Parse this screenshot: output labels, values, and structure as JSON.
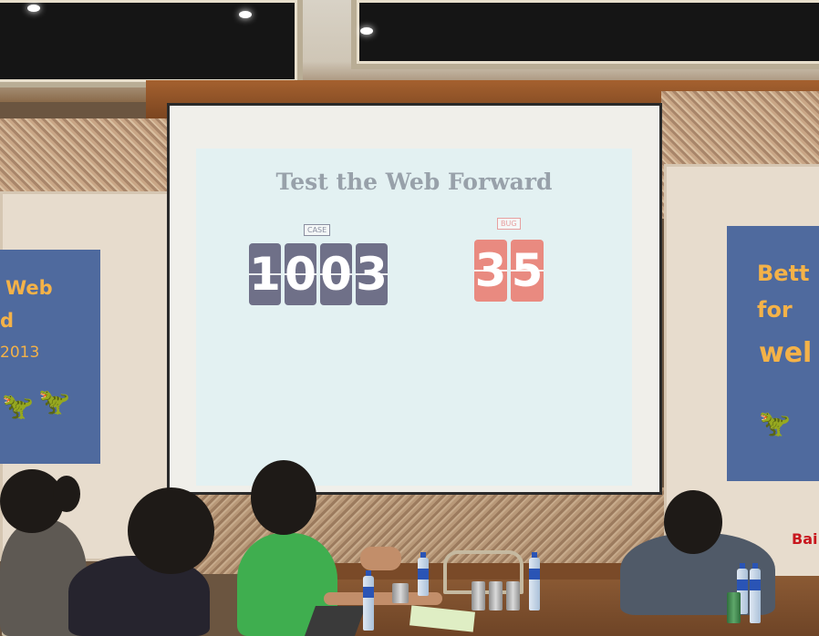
{
  "slide": {
    "title": "Test the Web Forward",
    "case_label": "CASE",
    "case_digits": [
      "1",
      "0",
      "0",
      "3"
    ],
    "bug_label": "BUG",
    "bug_digits": [
      "3",
      "5"
    ]
  },
  "banners": {
    "left_line1": "Web",
    "left_line2": "d",
    "left_line3": "2013",
    "right_line1": "Bett",
    "right_line2": "for",
    "right_line3": "wel",
    "sponsor_logo": "Bai"
  },
  "colors": {
    "slide_background": "#e3f1f2",
    "case_digit_tile": "#6f7088",
    "bug_digit_tile": "#e98a80",
    "banner_blue": "#4f6a9e",
    "banner_text": "#f4b248"
  }
}
